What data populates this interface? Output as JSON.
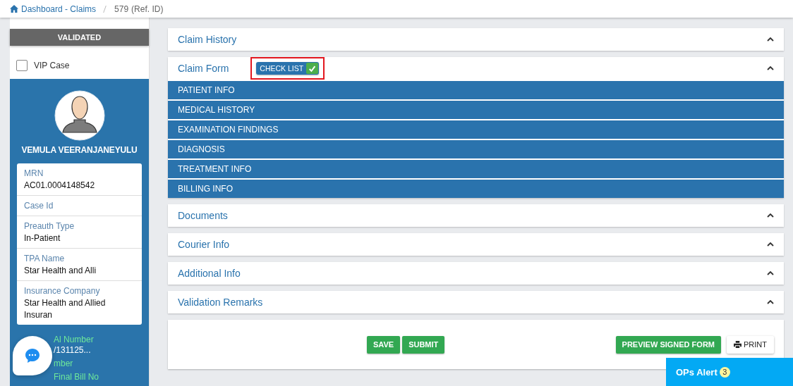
{
  "breadcrumb": {
    "link": "Dashboard - Claims",
    "current": "579",
    "ref": "(Ref. ID)"
  },
  "sidebar": {
    "status": "VALIDATED",
    "vip": {
      "label": "VIP Case",
      "checked": false
    },
    "patient_name": "VEMULA VEERANJANEYULU",
    "details": [
      {
        "label": "MRN",
        "value": "AC01.0004148542"
      },
      {
        "label": "Case Id"
      },
      {
        "label": "Preauth Type",
        "value": "In-Patient"
      },
      {
        "label": "TPA Name",
        "value": "Star Health and Alli"
      },
      {
        "label": "Insurance Company",
        "value": "Star Health and Allied Insuran"
      }
    ],
    "extra": [
      {
        "label": "Al Number",
        "value": "/131125..."
      },
      {
        "label": "mber"
      },
      {
        "label": "Final Bill No"
      }
    ]
  },
  "panels": [
    {
      "title": "Claim History"
    },
    {
      "title": "Claim Form",
      "badge": {
        "label": "CHECK LIST",
        "checked": true
      },
      "sections": [
        "PATIENT INFO",
        "MEDICAL HISTORY",
        "EXAMINATION FINDINGS",
        "DIAGNOSIS",
        "TREATMENT INFO",
        "BILLING INFO"
      ]
    },
    {
      "title": "Documents"
    },
    {
      "title": "Courier Info"
    },
    {
      "title": "Additional Info"
    },
    {
      "title": "Validation Remarks"
    }
  ],
  "actions": {
    "left": [
      "SAVE",
      "SUBMIT"
    ],
    "preview": "PREVIEW SIGNED FORM",
    "print": "PRINT"
  },
  "alert": {
    "label": "OPs Alert",
    "count": "3"
  }
}
